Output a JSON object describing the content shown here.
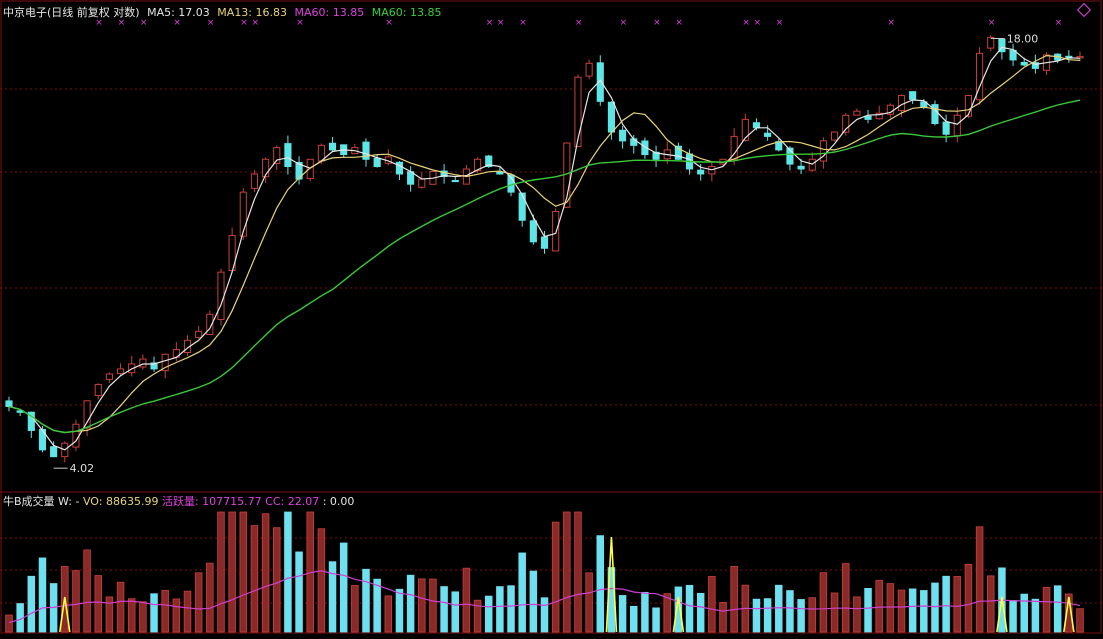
{
  "header": {
    "stock_name": "中京电子(日线 前复权 对数)",
    "ma5": "MA5: 17.03",
    "ma13": "MA13: 16.83",
    "ma60a": "MA60: 13.85",
    "ma60b": "MA60: 13.85"
  },
  "volume_header": {
    "title": "牛B成交量",
    "w": "W: -",
    "vo": "VO: 88635.99",
    "active_label": "活跃量",
    "active_value": ": 107715.77",
    "cc": "CC: 22.07",
    "extra": ": 0.00"
  },
  "annotations": {
    "high_label": "18.00",
    "low_label": "4.02"
  },
  "colors": {
    "background": "#000000",
    "up_candle": "#c8403a",
    "down_candle": "#5ee6e6",
    "ma5": "#e6e6e6",
    "ma13": "#e8d47a",
    "ma60": "#38c838",
    "grid": "#7a1010",
    "volume_avg": "#d040d0",
    "volume_signal": "#ffff40"
  },
  "chart_data": {
    "type": "candlestick",
    "scale": "log",
    "price_range": [
      3.8,
      19.5
    ],
    "sessions": 134,
    "first_session_index": 0,
    "closes_sampled": [
      4.9,
      4.8,
      4.5,
      4.2,
      4.1,
      4.3,
      4.6,
      5.0,
      5.3,
      5.5,
      5.6,
      5.7,
      5.8,
      5.6,
      5.9,
      6.0,
      6.2,
      6.4,
      6.8,
      7.9,
      9.0,
      10.5,
      11.2,
      11.8,
      12.3,
      11.5,
      11.0,
      11.8,
      12.4,
      12.2,
      12.0,
      12.3,
      11.8,
      11.5,
      11.9,
      11.2,
      10.8,
      11.0,
      11.3,
      11.1,
      10.9,
      11.4,
      11.8,
      11.5,
      11.2,
      10.5,
      9.5,
      8.8,
      8.6,
      9.8,
      12.5,
      15.8,
      16.6,
      14.5,
      13.0,
      12.6,
      12.4,
      12.0,
      11.8,
      12.2,
      11.8,
      11.4,
      11.2,
      11.5,
      11.8,
      12.8,
      13.6,
      13.2,
      12.8,
      12.2,
      11.6,
      11.4,
      11.8,
      12.6,
      13.0,
      13.8,
      14.0,
      13.6,
      13.9,
      14.3,
      14.8,
      14.6,
      14.2,
      13.4,
      12.9,
      13.8,
      14.8,
      17.2,
      18.2,
      17.3,
      16.8,
      16.5,
      16.3,
      17.1,
      16.8,
      16.9,
      17.0
    ],
    "ma5_last": 17.03,
    "ma13_last": 16.83,
    "ma60_last": 13.85,
    "high_marked": 18.0,
    "low_marked": 4.02,
    "volume": {
      "vo": 88635.99,
      "active": 107715.77,
      "cc": 22.07,
      "extra": 0.0
    }
  }
}
